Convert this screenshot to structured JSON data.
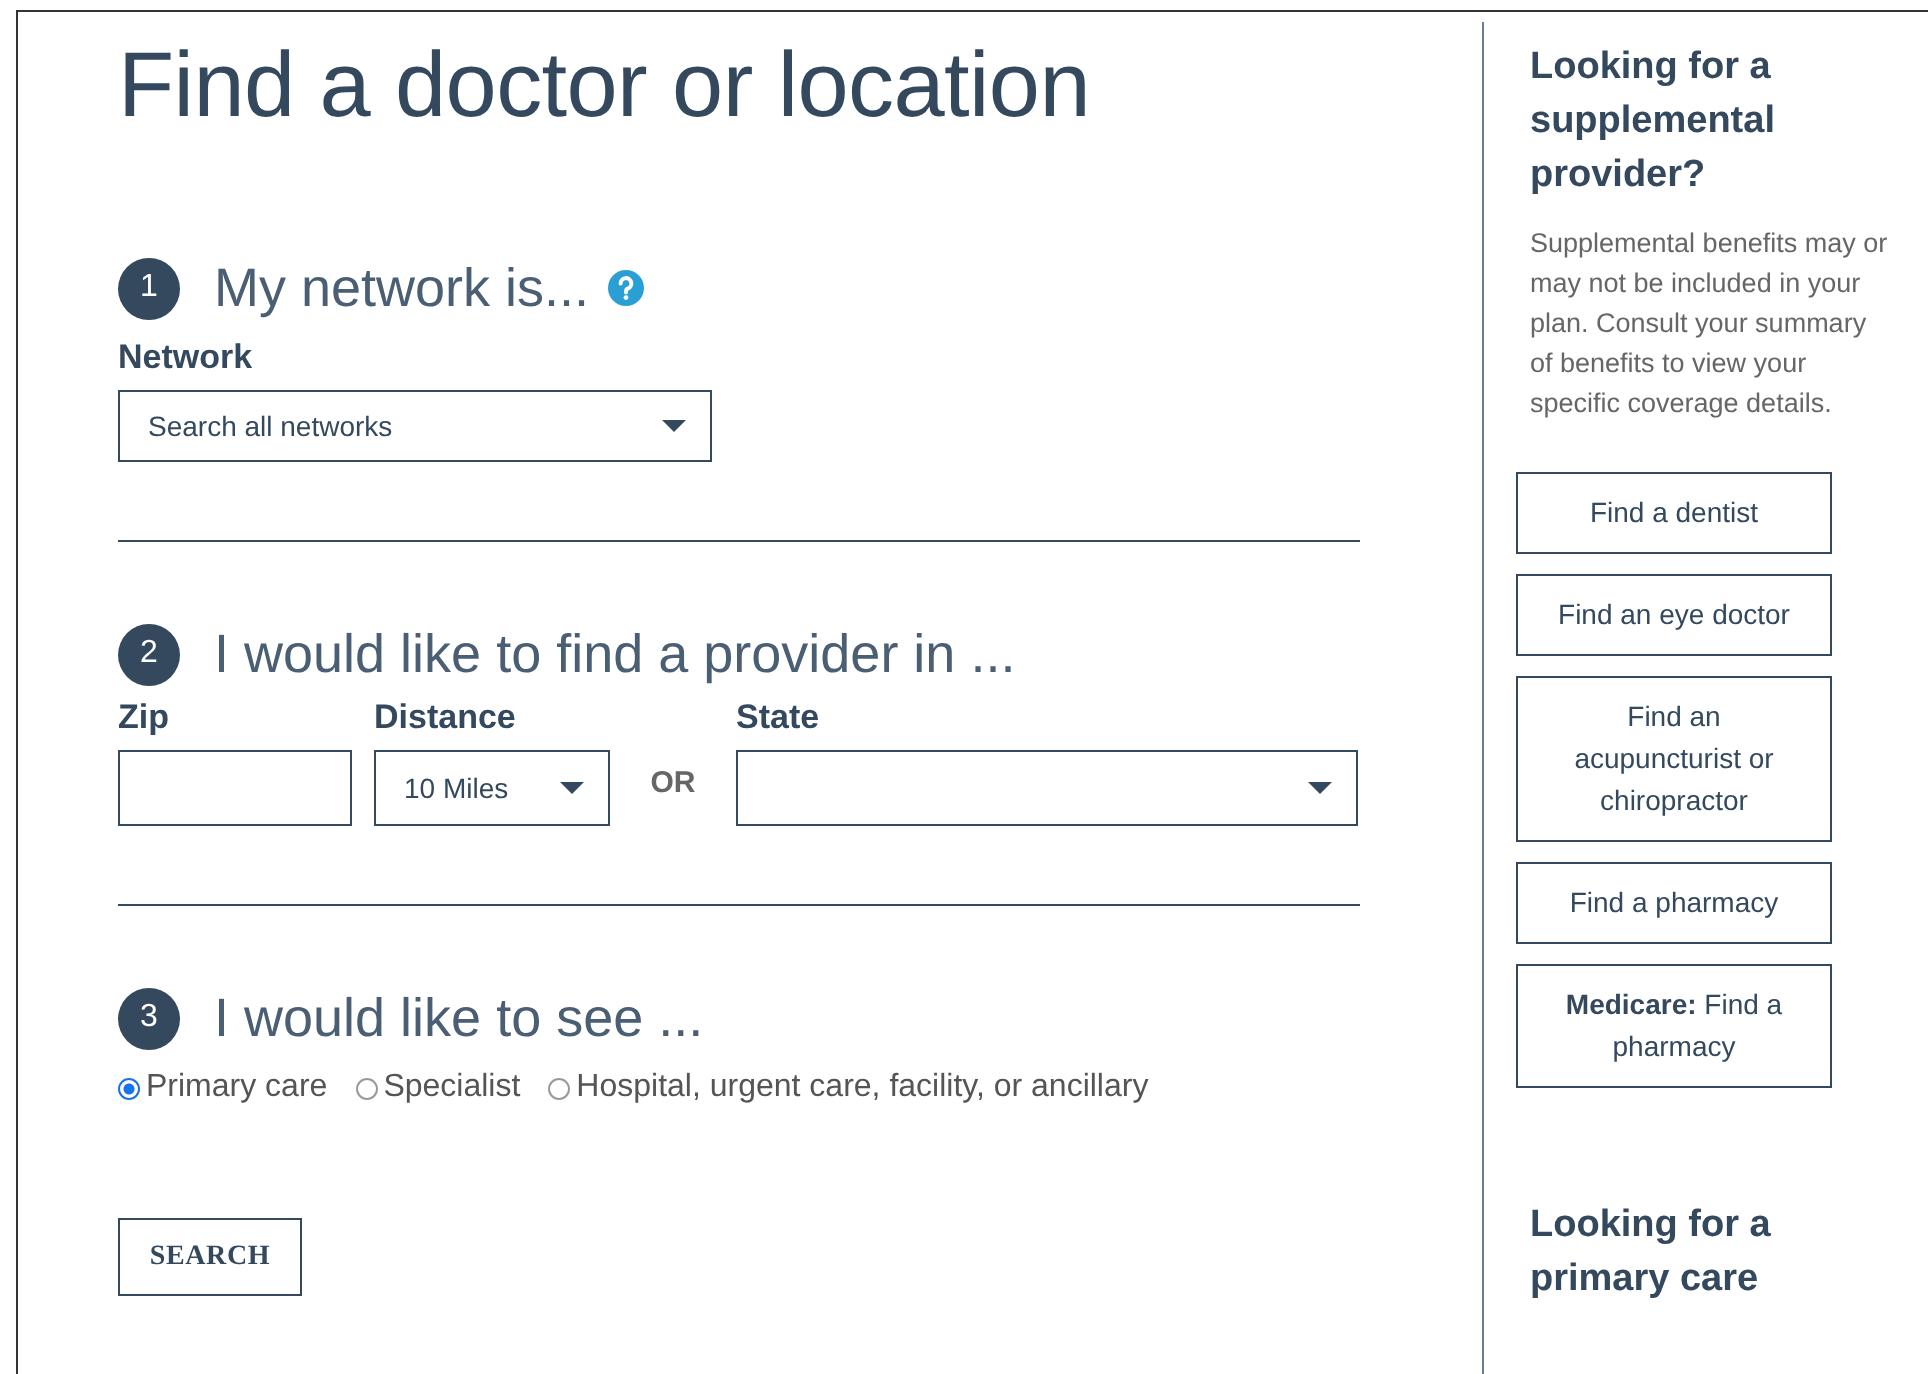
{
  "title": "Find a doctor or location",
  "network_section": {
    "number": "1",
    "heading": "My network is...",
    "field_label": "Network",
    "dropdown_value": "Search all networks"
  },
  "location_section": {
    "number": "2",
    "heading": "I would like to find a provider in ...",
    "zip_label": "Zip",
    "distance_label": "Distance",
    "distance_value": "10 Miles",
    "or_text": "OR",
    "state_label": "State"
  },
  "care_section": {
    "number": "3",
    "heading": "I would like to see ...",
    "options": [
      {
        "label": "Primary care",
        "selected": true
      },
      {
        "label": "Specialist",
        "selected": false
      },
      {
        "label": "Hospital, urgent care, facility, or ancillary",
        "selected": false
      }
    ]
  },
  "search_button": "SEARCH",
  "sidebar": {
    "heading": "Looking for a supplemental provider?",
    "text": "Supplemental benefits may or may not be included in your plan. Consult your summary of benefits to view your specific coverage details.",
    "links": [
      "Find a dentist",
      "Find an eye doctor",
      "Find an acupuncturist or chiropractor",
      "Find a pharmacy",
      "**Medicare:** Find a pharmacy"
    ],
    "next_heading": "Looking for a primary care"
  }
}
